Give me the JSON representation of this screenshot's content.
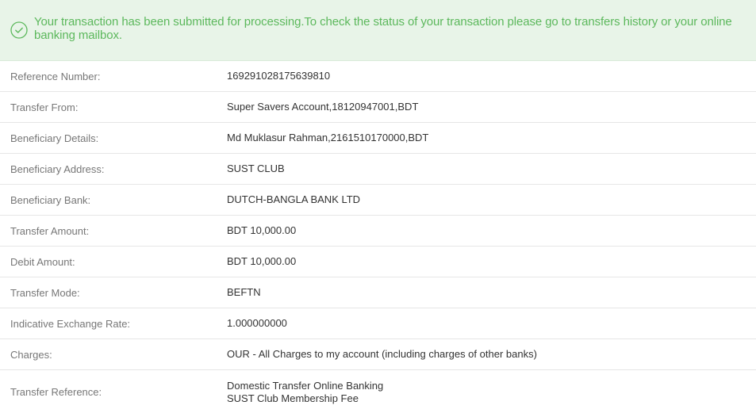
{
  "alert": {
    "icon": "check-circle-icon",
    "color": "#5cb85c",
    "message": "Your transaction has been submitted for processing.To check the status of your transaction please go to transfers history or your online banking mailbox."
  },
  "details": {
    "reference_number": {
      "label": "Reference Number:",
      "value": "169291028175639810"
    },
    "transfer_from": {
      "label": "Transfer From:",
      "value": "Super Savers Account,18120947001,BDT"
    },
    "beneficiary_details": {
      "label": "Beneficiary Details:",
      "value": "Md Muklasur Rahman,2161510170000,BDT"
    },
    "beneficiary_address": {
      "label": "Beneficiary Address:",
      "value": "SUST CLUB"
    },
    "beneficiary_bank": {
      "label": "Beneficiary Bank:",
      "value": "DUTCH-BANGLA BANK LTD"
    },
    "transfer_amount": {
      "label": "Transfer Amount:",
      "value": "BDT 10,000.00"
    },
    "debit_amount": {
      "label": "Debit Amount:",
      "value": "BDT 10,000.00"
    },
    "transfer_mode": {
      "label": "Transfer Mode:",
      "value": "BEFTN"
    },
    "exchange_rate": {
      "label": "Indicative Exchange Rate:",
      "value": "1.000000000"
    },
    "charges": {
      "label": "Charges:",
      "value": "OUR - All Charges to my account (including charges of other banks)"
    },
    "transfer_reference": {
      "label": "Transfer Reference:",
      "value_line1": "Domestic Transfer Online Banking",
      "value_line2": "SUST Club Membership Fee"
    }
  }
}
